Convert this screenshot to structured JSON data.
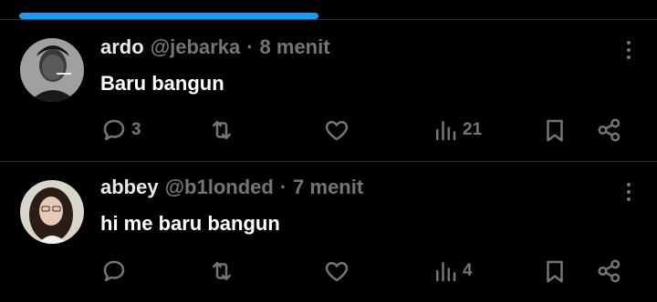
{
  "tweets": [
    {
      "name": "ardo",
      "handle": "@jebarka",
      "separator": "·",
      "time": "8 menit",
      "text": "Baru bangun",
      "replies": "3",
      "retweets": "",
      "likes": "",
      "views": "21"
    },
    {
      "name": "abbey",
      "handle": "@b1londed",
      "separator": "·",
      "time": "7 menit",
      "text": "hi me baru bangun",
      "replies": "",
      "retweets": "",
      "likes": "",
      "views": "4"
    }
  ],
  "icons": {
    "reply": "reply-icon",
    "retweet": "retweet-icon",
    "like": "heart-icon",
    "views": "views-icon",
    "bookmark": "bookmark-icon",
    "share": "share-icon",
    "more": "more-icon"
  },
  "colors": {
    "background": "#000000",
    "accent": "#1d9bf0",
    "muted": "#71767b",
    "text": "#e7e9ea"
  }
}
